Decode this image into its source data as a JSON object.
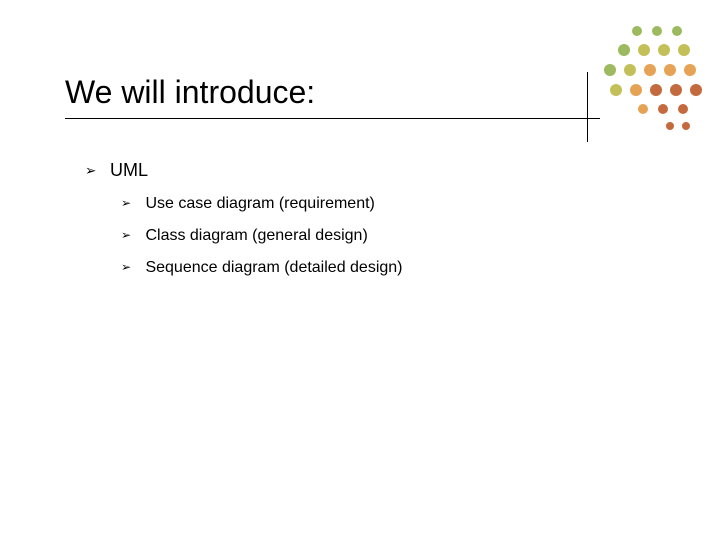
{
  "title": "We will introduce:",
  "bullet_glyph": "➢",
  "lvl1": {
    "item0": "UML"
  },
  "lvl2": {
    "item0": "Use case diagram (requirement)",
    "item1": "Class diagram (general design)",
    "item2": "Sequence diagram (detailed design)"
  },
  "decor_colors": {
    "green": "#9cba5f",
    "olive": "#c3c05a",
    "orange": "#e6a356",
    "rust": "#c46a3f"
  }
}
